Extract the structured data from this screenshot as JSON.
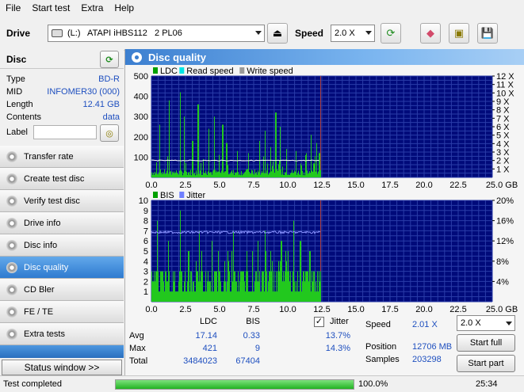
{
  "menu": [
    "File",
    "Start test",
    "Extra",
    "Help"
  ],
  "toolbar": {
    "drive_label": "Drive",
    "drive_value": "(L:)   ATAPI iHBS112   2 PL06",
    "speed_label": "Speed",
    "speed_value": "2.0 X"
  },
  "disc": {
    "header": "Disc",
    "rows": [
      {
        "key": "Type",
        "value": "BD-R"
      },
      {
        "key": "MID",
        "value": "INFOMER30 (000)"
      },
      {
        "key": "Length",
        "value": "12.41 GB"
      },
      {
        "key": "Contents",
        "value": "data"
      }
    ],
    "label_key": "Label",
    "label_value": ""
  },
  "nav": {
    "items": [
      "Transfer rate",
      "Create test disc",
      "Verify test disc",
      "Drive info",
      "Disc info",
      "Disc quality",
      "CD Bler",
      "FE / TE",
      "Extra tests"
    ],
    "active": "Disc quality",
    "status_window": "Status window >>"
  },
  "panel_title": "Disc quality",
  "chart_data": [
    {
      "type": "bar",
      "legend": [
        "LDC",
        "Read speed",
        "Write speed"
      ],
      "legend_colors": [
        "#00a000",
        "#00e5e5",
        "#9a9a9a"
      ],
      "x_ticks": [
        "0.0",
        "2.5",
        "5.0",
        "7.5",
        "10.0",
        "12.5",
        "15.0",
        "17.5",
        "20.0",
        "22.5",
        "25.0"
      ],
      "x_unit": "GB",
      "xlim": [
        0,
        25
      ],
      "y_ticks": [
        "500",
        "400",
        "300",
        "200",
        "100"
      ],
      "ylim": [
        0,
        500
      ],
      "y2_ticks": [
        "12 X",
        "11 X",
        "10 X",
        "9 X",
        "8 X",
        "7 X",
        "6 X",
        "5 X",
        "4 X",
        "3 X",
        "2 X",
        "1 X"
      ],
      "y2lim": [
        0,
        12
      ],
      "data_extent_gb": 12.41,
      "ldc_baseline": 25,
      "ldc_peaks": [
        [
          0.6,
          260
        ],
        [
          1.3,
          380
        ],
        [
          2.1,
          420
        ],
        [
          2.4,
          300
        ],
        [
          3.0,
          180
        ],
        [
          3.4,
          360
        ],
        [
          4.2,
          240
        ],
        [
          4.6,
          300
        ],
        [
          5.2,
          260
        ],
        [
          5.5,
          170
        ],
        [
          6.3,
          130
        ],
        [
          7.1,
          120
        ],
        [
          7.9,
          180
        ],
        [
          8.3,
          230
        ],
        [
          8.7,
          150
        ],
        [
          9.1,
          320
        ],
        [
          9.4,
          250
        ],
        [
          9.9,
          140
        ],
        [
          10.6,
          130
        ],
        [
          11.3,
          110
        ],
        [
          11.7,
          210
        ],
        [
          12.1,
          170
        ],
        [
          12.3,
          120
        ]
      ],
      "read_speed_x": 2.0,
      "read_speed_color": "#ffffff"
    },
    {
      "type": "bar",
      "legend": [
        "BIS",
        "Jitter"
      ],
      "legend_colors": [
        "#00a000",
        "#6f7fff"
      ],
      "x_ticks": [
        "0.0",
        "2.5",
        "5.0",
        "7.5",
        "10.0",
        "12.5",
        "15.0",
        "17.5",
        "20.0",
        "22.5",
        "25.0"
      ],
      "x_unit": "GB",
      "xlim": [
        0,
        25
      ],
      "y_ticks": [
        "10",
        "9",
        "8",
        "7",
        "6",
        "5",
        "4",
        "3",
        "2",
        "1"
      ],
      "ylim": [
        0,
        10
      ],
      "y2_ticks": [
        "20%",
        "16%",
        "12%",
        "8%",
        "4%"
      ],
      "y2lim": [
        0,
        20
      ],
      "data_extent_gb": 12.41,
      "bis_peaks": [
        [
          0.4,
          8
        ],
        [
          1.2,
          6
        ],
        [
          2.1,
          9
        ],
        [
          2.7,
          5
        ],
        [
          3.5,
          7
        ],
        [
          4.4,
          6
        ],
        [
          5.6,
          5
        ],
        [
          6.0,
          7
        ],
        [
          7.0,
          5
        ],
        [
          7.8,
          6
        ],
        [
          8.3,
          7
        ],
        [
          8.7,
          5
        ],
        [
          9.5,
          6
        ],
        [
          10.4,
          8
        ],
        [
          10.9,
          6
        ],
        [
          11.6,
          5
        ]
      ],
      "jitter_percent": 13.7
    }
  ],
  "stats": {
    "col_ldc": "LDC",
    "col_bis": "BIS",
    "jitter_label": "Jitter",
    "jitter_checked": "✓",
    "row_avg": "Avg",
    "row_max": "Max",
    "row_total": "Total",
    "avg_ldc": "17.14",
    "avg_bis": "0.33",
    "avg_jitter": "13.7%",
    "max_ldc": "421",
    "max_bis": "9",
    "max_jitter": "14.3%",
    "total_ldc": "3484023",
    "total_bis": "67404",
    "speed_label": "Speed",
    "speed_value": "2.01 X",
    "position_label": "Position",
    "position_value": "12706 MB",
    "samples_label": "Samples",
    "samples_value": "203298",
    "speed_select": "2.0 X",
    "start_full": "Start full",
    "start_part": "Start part"
  },
  "status": {
    "text": "Test completed",
    "progress_percent": 100,
    "progress_text": "100.0%",
    "time": "25:34"
  }
}
